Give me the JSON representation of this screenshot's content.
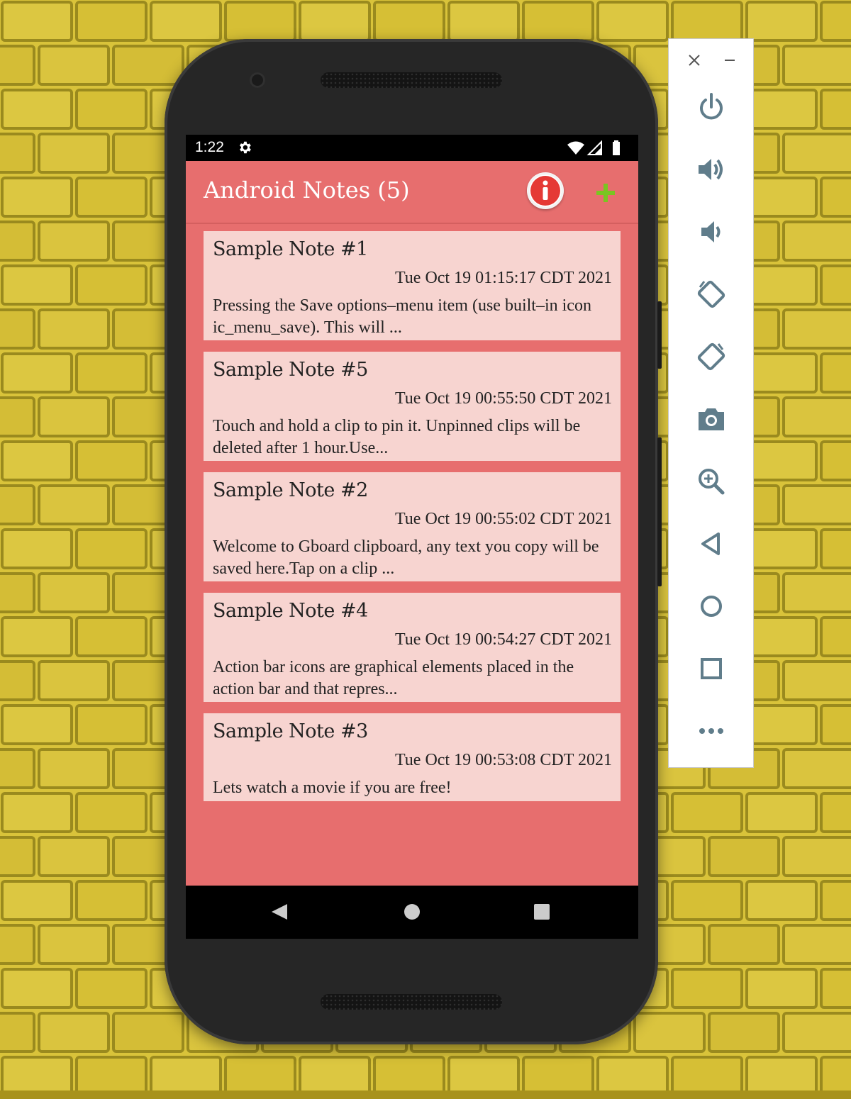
{
  "status_bar": {
    "time": "1:22",
    "left_icons": [
      "gear-icon"
    ],
    "right_icons": [
      "wifi-icon",
      "signal-icon",
      "battery-icon"
    ]
  },
  "app_bar": {
    "title": "Android Notes (5)",
    "actions": [
      {
        "name": "info-icon",
        "color": "#e53935"
      },
      {
        "name": "add-icon",
        "color": "#7ac521"
      }
    ]
  },
  "colors": {
    "background": "#e76e6e",
    "card": "#f7d4d0",
    "text": "#222222",
    "wall": "#d2ba33"
  },
  "notes": [
    {
      "title": "Sample Note #1",
      "date": "Tue Oct 19 01:15:17 CDT 2021",
      "preview": "Pressing the Save options–menu item (use built–in icon ic_menu_save). This will ..."
    },
    {
      "title": "Sample Note #5",
      "date": "Tue Oct 19 00:55:50 CDT 2021",
      "preview": "Touch and hold a clip to pin it. Unpinned clips will be deleted after 1 hour.Use..."
    },
    {
      "title": "Sample Note #2",
      "date": "Tue Oct 19 00:55:02 CDT 2021",
      "preview": "Welcome to Gboard clipboard, any text you copy will be saved here.Tap on a clip ..."
    },
    {
      "title": "Sample Note #4",
      "date": "Tue Oct 19 00:54:27 CDT 2021",
      "preview": "Action bar icons are graphical elements placed in the action bar and that repres..."
    },
    {
      "title": "Sample Note #3",
      "date": "Tue Oct 19 00:53:08 CDT 2021",
      "preview": "Lets watch a movie if you are free!"
    }
  ],
  "nav_bar": [
    "back-icon",
    "home-icon",
    "recents-icon"
  ],
  "emulator_panel": {
    "window_controls": [
      "close-icon",
      "minimize-icon"
    ],
    "buttons": [
      "power-icon",
      "volume-up-icon",
      "volume-down-icon",
      "rotate-left-icon",
      "rotate-right-icon",
      "camera-icon",
      "zoom-icon",
      "back-icon",
      "home-icon",
      "overview-icon",
      "more-icon"
    ]
  }
}
